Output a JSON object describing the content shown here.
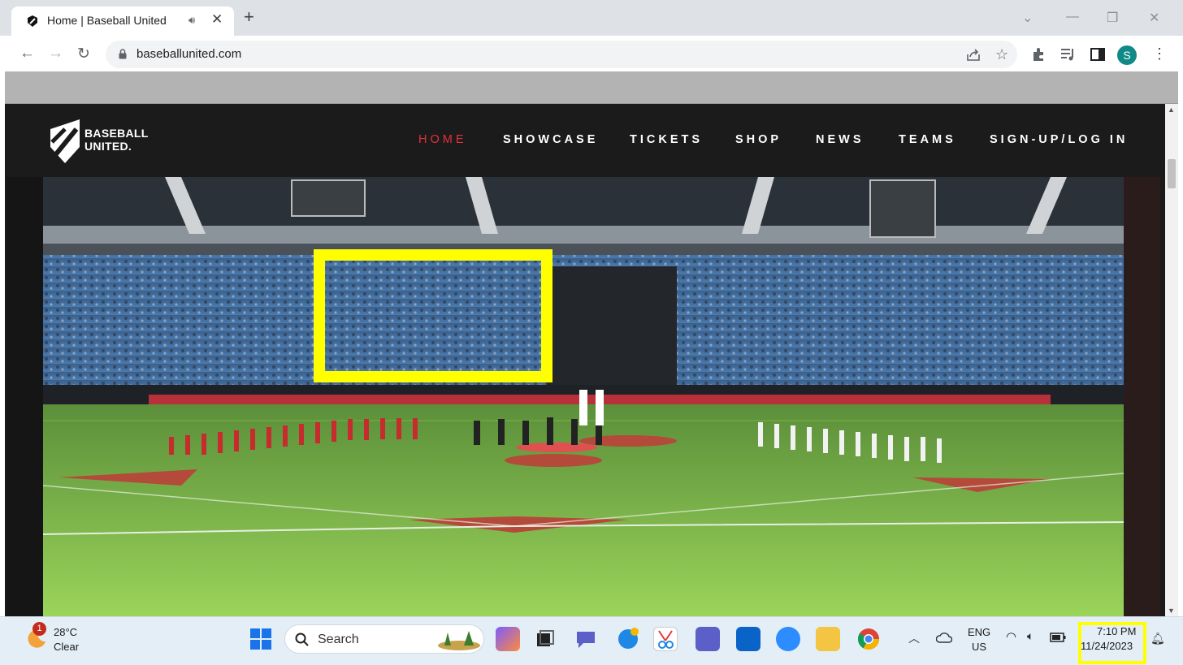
{
  "browser": {
    "tab_title": "Home | Baseball United",
    "url": "baseballunited.com",
    "profile_initial": "S"
  },
  "site": {
    "logo_line1": "BASEBALL",
    "logo_line2": "UNITED.",
    "nav": [
      "HOME",
      "SHOWCASE",
      "TICKETS",
      "SHOP",
      "NEWS",
      "TEAMS",
      "SIGN-UP/LOG IN"
    ],
    "active_nav": "HOME",
    "accent_color": "#e2323a"
  },
  "taskbar": {
    "weather_temp": "28°C",
    "weather_desc": "Clear",
    "weather_badge": "1",
    "search_label": "Search",
    "lang_line1": "ENG",
    "lang_line2": "US",
    "time": "7:10 PM",
    "date": "11/24/2023",
    "pinned_apps": [
      "windows-start",
      "search",
      "copilot-pre",
      "task-view",
      "teams-chat",
      "get-help",
      "snipping-tool",
      "teams",
      "outlook",
      "zoom",
      "file-explorer",
      "chrome"
    ]
  },
  "annotation_color": "#ffff00"
}
